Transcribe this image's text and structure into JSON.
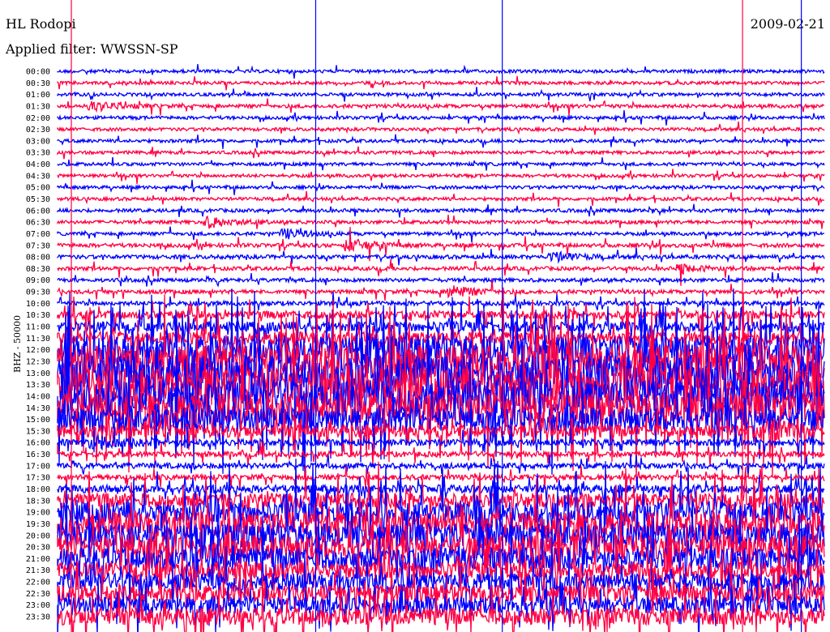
{
  "header": {
    "station": "HL Rodopi",
    "date": "2009-02-21",
    "filter": "Applied filter: WWSSN-SP"
  },
  "chart_data": {
    "type": "line",
    "title": "HL Rodopi",
    "ylabel": "BHZ - 50000",
    "xlabel": "",
    "minutes_per_line": 30,
    "colors": [
      "#0000ff",
      "#ff0044"
    ],
    "rows": [
      "00:00",
      "00:30",
      "01:00",
      "01:30",
      "02:00",
      "02:30",
      "03:00",
      "03:30",
      "04:00",
      "04:30",
      "05:00",
      "05:30",
      "06:00",
      "06:30",
      "07:00",
      "07:30",
      "08:00",
      "08:30",
      "09:00",
      "09:30",
      "10:00",
      "10:30",
      "11:00",
      "11:30",
      "12:00",
      "12:30",
      "13:00",
      "13:30",
      "14:00",
      "14:30",
      "15:00",
      "15:30",
      "16:00",
      "16:30",
      "17:00",
      "17:30",
      "18:00",
      "18:30",
      "19:00",
      "19:30",
      "20:00",
      "20:30",
      "21:00",
      "21:30",
      "22:00",
      "22:30",
      "23:00",
      "23:30"
    ],
    "noise_level": [
      1,
      1,
      1,
      1.2,
      1,
      1,
      1,
      1,
      1,
      1,
      1,
      1,
      1.1,
      1.1,
      1.1,
      1.3,
      1.3,
      1.2,
      1.2,
      1.3,
      1.5,
      3,
      4,
      5,
      12,
      14,
      15,
      15,
      14,
      13,
      10,
      5,
      2.5,
      2,
      2,
      2,
      3,
      6,
      9,
      10,
      10,
      10,
      9,
      7,
      7,
      7,
      7,
      7
    ],
    "events": [
      {
        "row": "01:30",
        "minute": 1.5,
        "amp": 5
      },
      {
        "row": "06:30",
        "minute": 6,
        "amp": 6
      },
      {
        "row": "07:00",
        "minute": 9,
        "amp": 5
      },
      {
        "row": "07:30",
        "minute": 11.5,
        "amp": 7
      },
      {
        "row": "08:00",
        "minute": 19.5,
        "amp": 5
      },
      {
        "row": "08:30",
        "minute": 24.5,
        "amp": 4
      },
      {
        "row": "09:30",
        "minute": 15.5,
        "amp": 7
      },
      {
        "row": "16:00",
        "minute": 1.5,
        "amp": 5
      },
      {
        "row": "15:30",
        "minute": 28,
        "amp": 8
      }
    ],
    "spikes": [
      {
        "minute": 0.54,
        "color": "#ff0044"
      },
      {
        "minute": 10.1,
        "color": "#0000ff"
      },
      {
        "minute": 17.4,
        "color": "#0000ff"
      },
      {
        "minute": 26.8,
        "color": "#ff0044"
      },
      {
        "minute": 29.1,
        "color": "#0000ff"
      }
    ]
  }
}
